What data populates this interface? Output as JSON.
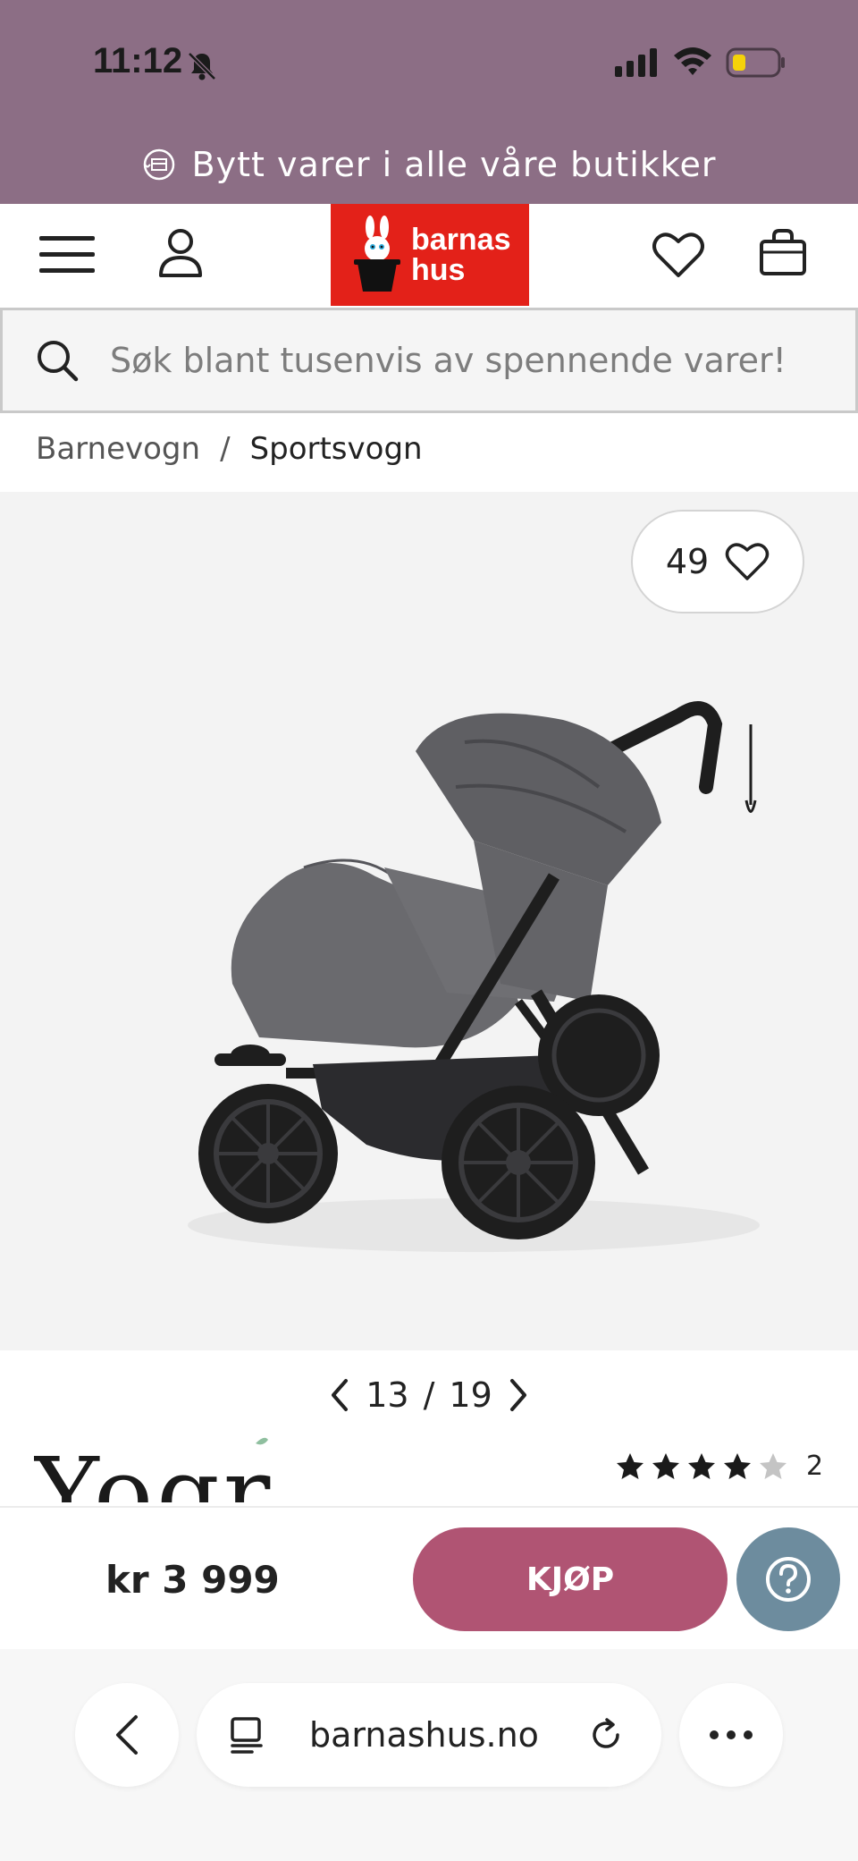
{
  "status_bar": {
    "time": "11:12",
    "icons": [
      "bell-slash-icon",
      "signal-icon",
      "wifi-icon",
      "battery-low-icon"
    ]
  },
  "promo": {
    "text": "Bytt varer i alle våre butikker",
    "icon": "exchange-box-icon"
  },
  "header": {
    "logo_line1": "barnas",
    "logo_line2": "hus",
    "logo_color": "#e32119",
    "icons": [
      "menu-icon",
      "user-icon",
      "heart-icon",
      "bag-icon"
    ]
  },
  "search": {
    "placeholder": "Søk blant tusenvis av spennende varer!"
  },
  "breadcrumb": {
    "items": [
      "Barnevogn",
      "Sportsvogn"
    ],
    "separator": "/"
  },
  "gallery": {
    "favorite_count": "49",
    "current": "13",
    "separator": "/",
    "total": "19"
  },
  "product": {
    "brand": "Yogri",
    "rating_value": 4,
    "rating_max": 5,
    "review_count": "2",
    "price": "kr 3 999"
  },
  "buy_bar": {
    "buy_label": "KJØP",
    "buy_color": "#b05473",
    "help_color": "#6d8c9e"
  },
  "browser": {
    "url": "barnashus.no",
    "icons": [
      "back-icon",
      "reader-icon",
      "reload-icon",
      "more-icon"
    ]
  }
}
